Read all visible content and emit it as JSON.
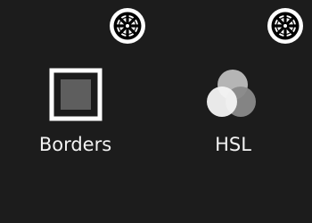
{
  "tools": [
    {
      "label": "Borders",
      "icon": "square-border-icon",
      "settings_icon": "gear-icon"
    },
    {
      "label": "HSL",
      "icon": "color-circles-icon",
      "settings_icon": "gear-icon"
    }
  ],
  "colors": {
    "background": "#1c1c1c",
    "text": "#f2f2f2",
    "gear_fill": "#ffffff",
    "gear_ink": "#000000"
  }
}
